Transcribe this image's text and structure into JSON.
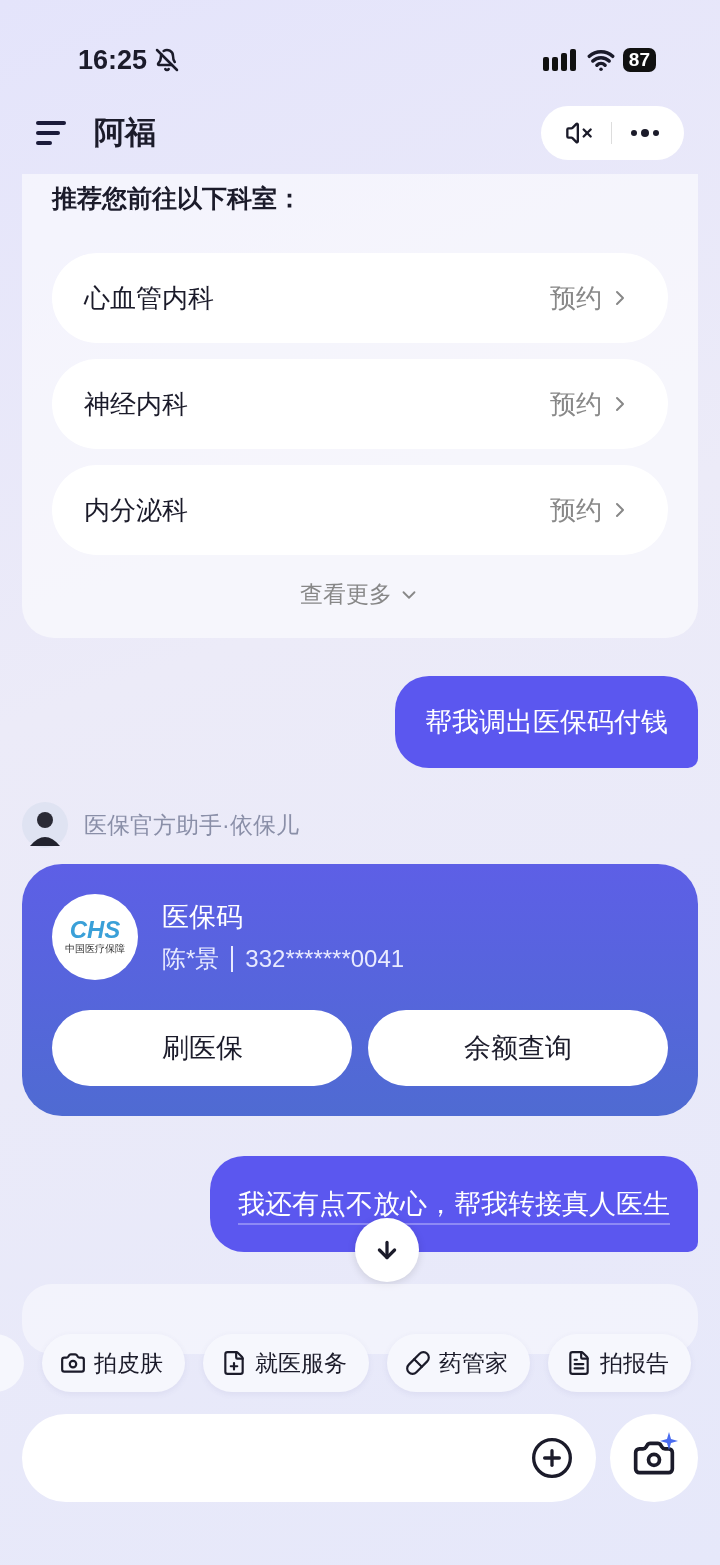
{
  "status_bar": {
    "time": "16:25",
    "battery": "87"
  },
  "header": {
    "title": "阿福"
  },
  "departments": {
    "heading": "推荐您前往以下科室：",
    "items": [
      {
        "name": "心血管内科",
        "action": "预约"
      },
      {
        "name": "神经内科",
        "action": "预约"
      },
      {
        "name": "内分泌科",
        "action": "预约"
      }
    ],
    "more": "查看更多"
  },
  "user_message_1": "帮我调出医保码付钱",
  "assistant": {
    "name": "医保官方助手·依保儿"
  },
  "insurance_card": {
    "logo_mark": "CHS",
    "logo_caption": "中国医疗保障",
    "title": "医保码",
    "holder": "陈*景",
    "number": "332*******0041",
    "buttons": [
      "刷医保",
      "余额查询"
    ]
  },
  "user_message_2": "我还有点不放心，帮我转接真人医生",
  "quick_actions": [
    {
      "label": "拍皮肤"
    },
    {
      "label": "就医服务"
    },
    {
      "label": "药管家"
    },
    {
      "label": "拍报告"
    }
  ]
}
